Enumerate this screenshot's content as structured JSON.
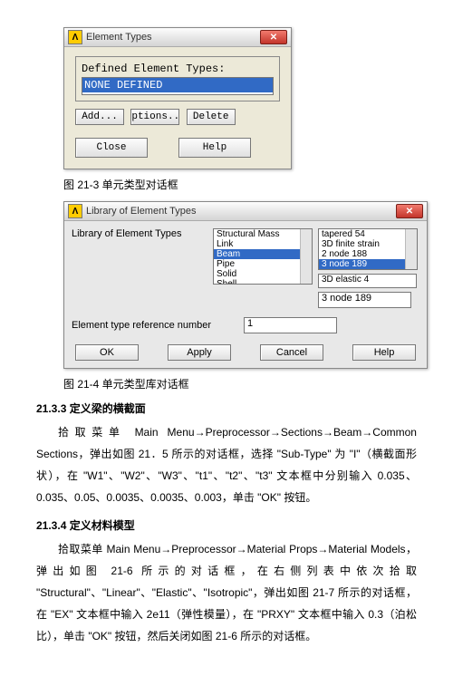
{
  "dialog1": {
    "title": "Element Types",
    "defined_label": "Defined Element Types:",
    "list_selected": "NONE DEFINED",
    "btn_add": "Add...",
    "btn_options": "ptions..",
    "btn_delete": "Delete",
    "btn_close": "Close",
    "btn_help": "Help"
  },
  "caption1": "图 21-3 单元类型对话框",
  "dialog2": {
    "title": "Library of Element Types",
    "lib_label": "Library of Element Types",
    "list1": [
      "Structural Mass",
      "Link",
      "Beam",
      "Pipe",
      "Solid",
      "Shell"
    ],
    "list1_selected_index": 2,
    "list2a": [
      "tapered    54",
      "3D finite strain",
      "2 node   188",
      "3 node   189"
    ],
    "list2a_selected_index": 3,
    "list2b": [
      "3D elastic    4"
    ],
    "ref_label": "Element type reference number",
    "ref_value": "1",
    "selected_value": "3 node   189",
    "btn_ok": "OK",
    "btn_apply": "Apply",
    "btn_cancel": "Cancel",
    "btn_help": "Help"
  },
  "caption2": "图 21-4 单元类型库对话框",
  "sec1_heading": "21.3.3 定义梁的横截面",
  "sec1_p1": "拾取菜单 Main Menu→Preprocessor→Sections→Beam→Common Sections，弹出如图 21．5 所示的对话框，选择 \"Sub-Type\" 为 \"I\"（横截面形状），在 \"W1\"、\"W2\"、\"W3\"、\"t1\"、\"t2\"、\"t3\" 文本框中分别输入 0.035、0.035、0.05、0.0035、0.0035、0.003，单击 \"OK\" 按钮。",
  "sec2_heading": "21.3.4 定义材料模型",
  "sec2_p1": "拾取菜单 Main Menu→Preprocessor→Material Props→Material Models，弹出如图 21-6 所示的对话框，在右侧列表中依次拾取 \"Structural\"、\"Linear\"、\"Elastic\"、\"Isotropic\"，弹出如图 21-7 所示的对话框，在 \"EX\" 文本框中输入 2e11（弹性模量），在 \"PRXY\" 文本框中输入 0.3（泊松比），单击 \"OK\" 按钮，然后关闭如图 21-6 所示的对话框。"
}
